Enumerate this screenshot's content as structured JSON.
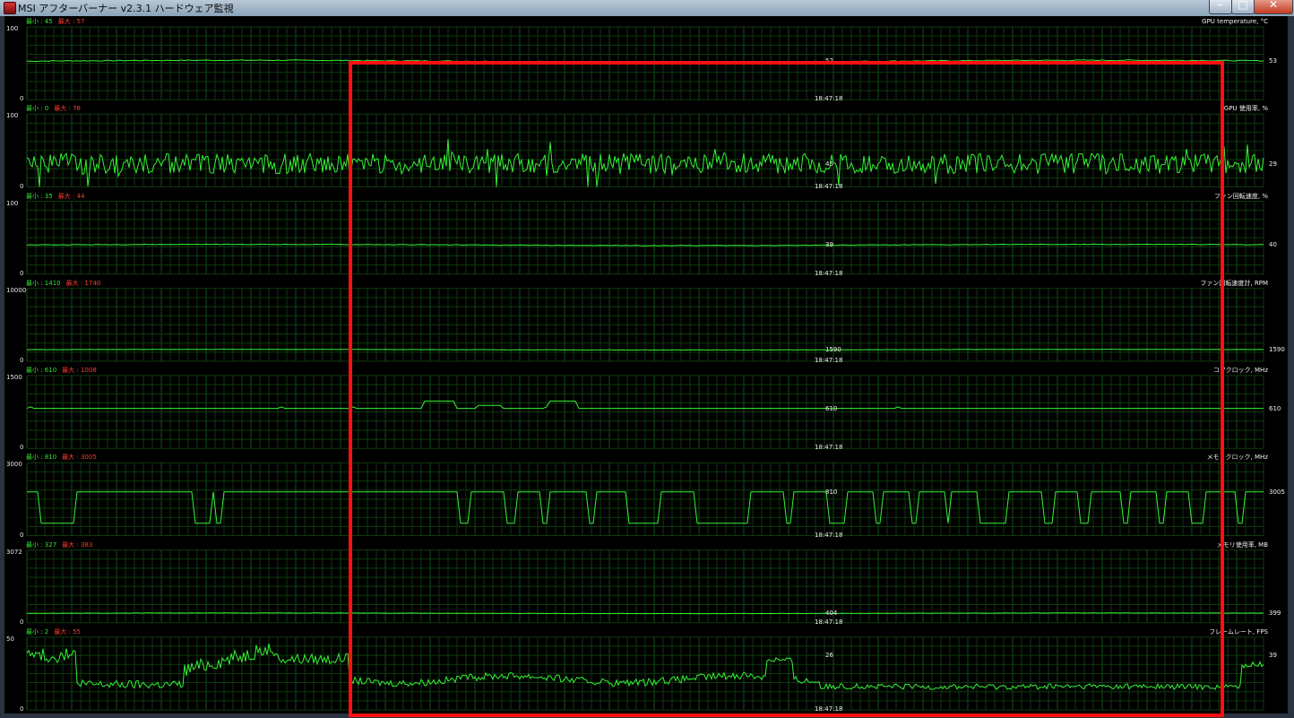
{
  "window": {
    "title": "MSI アフターバーナー v2.3.1 ハードウェア監視"
  },
  "graphs": [
    {
      "title": "GPU temperature, °C",
      "min_label": "最小 : 45",
      "max_label": "最大 : 57",
      "y_max": "100",
      "y_min": "0",
      "current_value": "53",
      "cursor_value": "52",
      "timestamp": "18:47:18",
      "trace": "flat",
      "level": 0.53,
      "noise": 0.012
    },
    {
      "title": "GPU 使用率, %",
      "min_label": "最小 : 0",
      "max_label": "最大 : 78",
      "y_max": "100",
      "y_min": "0",
      "current_value": "29",
      "cursor_value": "45",
      "timestamp": "18:47:18",
      "trace": "noisy",
      "level": 0.32,
      "noise": 0.28
    },
    {
      "title": "ファン回転速度, %",
      "min_label": "最小 : 35",
      "max_label": "最大 : 44",
      "y_max": "100",
      "y_min": "0",
      "current_value": "40",
      "cursor_value": "39",
      "timestamp": "18:47:18",
      "trace": "flat",
      "level": 0.4,
      "noise": 0.008
    },
    {
      "title": "ファン回転速度計, RPM",
      "min_label": "最小 : 1410",
      "max_label": "最大 : 1740",
      "y_max": "10000",
      "y_min": "0",
      "current_value": "1590",
      "cursor_value": "1590",
      "timestamp": "18:47:18",
      "trace": "flat",
      "level": 0.159,
      "noise": 0.004
    },
    {
      "title": "コアクロック, MHz",
      "min_label": "最小 : 610",
      "max_label": "最大 : 1008",
      "y_max": "1500",
      "y_min": "0",
      "current_value": "610",
      "cursor_value": "610",
      "timestamp": "18:47:18",
      "trace": "core",
      "level": 0.55,
      "noise": 0
    },
    {
      "title": "メモリクロック, MHz",
      "min_label": "最小 : 810",
      "max_label": "最大 : 3005",
      "y_max": "3000",
      "y_min": "0",
      "current_value": "3005",
      "cursor_value": "810",
      "timestamp": "18:47:18",
      "trace": "square",
      "level": 0.6,
      "noise": 0
    },
    {
      "title": "メモリ使用率, MB",
      "min_label": "最小 : 327",
      "max_label": "最大 : 383",
      "y_max": "3072",
      "y_min": "0",
      "current_value": "399",
      "cursor_value": "404",
      "timestamp": "18:47:18",
      "trace": "flat",
      "level": 0.13,
      "noise": 0.004
    },
    {
      "title": "フレームレート, FPS",
      "min_label": "最小 : 2",
      "max_label": "最大 : 55",
      "y_max": "50",
      "y_min": "0",
      "current_value": "39",
      "cursor_value": "26",
      "timestamp": "18:47:18",
      "trace": "fps",
      "level": 0.45,
      "noise": 0.1
    }
  ],
  "colors": {
    "trace": "#34f234",
    "grid": "#0e3a0e",
    "grid_major": "#145014",
    "selection": "#ff1010"
  }
}
